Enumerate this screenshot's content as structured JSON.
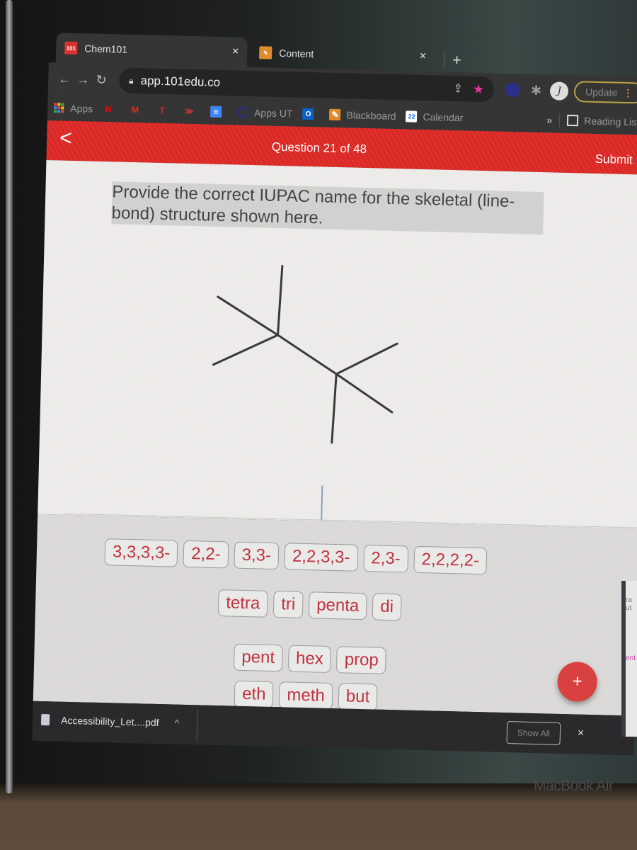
{
  "browser": {
    "tabs": [
      {
        "title": "Chem101",
        "favicon": "101-logo-icon",
        "active": true
      },
      {
        "title": "Content",
        "favicon": "pencil-icon",
        "active": false
      }
    ],
    "new_tab_symbol": "+",
    "close_symbol": "×",
    "address": "app.101edu.co",
    "update_label": "Update",
    "avatar_initial": "J",
    "bookmarks": [
      {
        "label": "Apps",
        "icon": "apps-grid-icon"
      },
      {
        "label": "",
        "icon": "netflix-icon"
      },
      {
        "label": "",
        "icon": "gmail-icon"
      },
      {
        "label": "",
        "icon": "university-icon"
      },
      {
        "label": "",
        "icon": "arrow-icon"
      },
      {
        "label": "",
        "icon": "docs-icon"
      },
      {
        "label": "Apps UT",
        "icon": "circle-icon"
      },
      {
        "label": "",
        "icon": "outlook-icon"
      },
      {
        "label": "Blackboard",
        "icon": "pencil-icon"
      },
      {
        "label": "Calendar",
        "icon": "calendar-icon",
        "icon_text": "22"
      }
    ],
    "overflow_symbol": "»",
    "reading_list_label": "Reading List"
  },
  "question": {
    "back_symbol": "<",
    "counter": "Question 21 of 48",
    "submit_label": "Submit",
    "prompt": "Provide the correct IUPAC name for the skeletal (line-bond) structure shown here.",
    "structure": "2,2,3,3-tetramethylbutane skeletal drawing"
  },
  "answer_bank": {
    "locants": [
      "3,3,3,3-",
      "2,2-",
      "3,3-",
      "2,2,3,3-",
      "2,3-",
      "2,2,2,2-"
    ],
    "multipliers": [
      "tetra",
      "tri",
      "penta",
      "di"
    ],
    "roots_row1": [
      "pent",
      "hex",
      "prop"
    ],
    "roots_row2": [
      "eth",
      "meth",
      "but"
    ],
    "add_symbol": "+"
  },
  "downloads": {
    "file_name": "Accessibility_Let....pdf",
    "caret": "^",
    "show_all_label": "Show All",
    "close_symbol": "×"
  },
  "side_window": {
    "line1": "ra",
    "line2": "ut",
    "line3": "ent"
  },
  "device_label": "MacBook Air",
  "colors": {
    "header_red": "#e2302c",
    "chip_text": "#c2323f",
    "fab": "#d94040",
    "star": "#e8389c"
  }
}
